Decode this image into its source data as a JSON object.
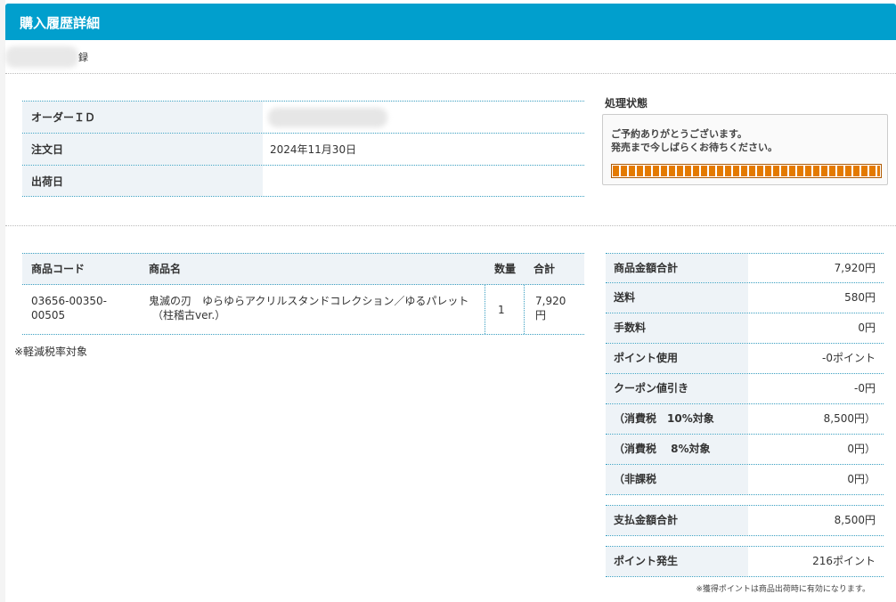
{
  "header": {
    "title": "購入履歴詳細"
  },
  "breadcrumb": {
    "suffix": "録"
  },
  "order": {
    "rows": [
      {
        "label": "オーダーＩＤ",
        "value": ""
      },
      {
        "label": "注文日",
        "value": "2024年11月30日"
      },
      {
        "label": "出荷日",
        "value": ""
      }
    ]
  },
  "status": {
    "title": "処理状態",
    "message_line1": "ご予約ありがとうございます。",
    "message_line2": "発売まで今しばらくお待ちください。",
    "progress": 1.0,
    "progress_color": "#e47a00"
  },
  "items": {
    "headers": {
      "code": "商品コード",
      "name": "商品名",
      "qty": "数量",
      "total": "合計"
    },
    "rows": [
      {
        "code_line1": "03656-00350-",
        "code_line2": "00505",
        "name_line1": "鬼滅の刃　ゆらゆらアクリルスタンドコレクション／ゆるパレット",
        "name_line2": "（柱稽古ver.）",
        "qty": "1",
        "total_line1": "7,920",
        "total_line2": "円"
      }
    ]
  },
  "tax_note": "※軽減税率対象",
  "summary": {
    "rows": [
      {
        "label": "商品金額合計",
        "value": "7,920円"
      },
      {
        "label": "送料",
        "value": "580円"
      },
      {
        "label": "手数料",
        "value": "0円"
      },
      {
        "label": "ポイント使用",
        "value": "-0ポイント"
      },
      {
        "label": "クーポン値引き",
        "value": "-0円"
      },
      {
        "label": "（消費税　10%対象",
        "value": "8,500円）"
      },
      {
        "label": "（消費税　 8%対象",
        "value": "0円）"
      },
      {
        "label": "（非課税",
        "value": "0円）"
      }
    ],
    "payment": {
      "label": "支払金額合計",
      "value": "8,500円"
    },
    "points": {
      "label": "ポイント発生",
      "value": "216ポイント"
    }
  },
  "point_note": "※獲得ポイントは商品出荷時に有効になります。",
  "colors": {
    "header_bg": "#019fcd",
    "label_bg": "#eef3f7",
    "border": "#3a9fc1"
  }
}
